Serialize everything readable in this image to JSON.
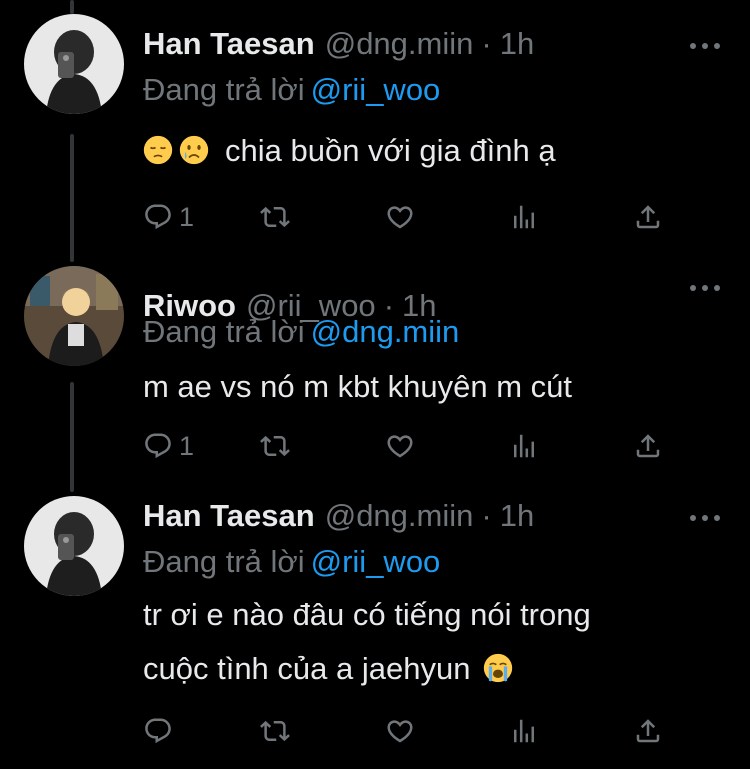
{
  "tweets": [
    {
      "name": "Han Taesan",
      "handle": "@dng.miin",
      "separator": "·",
      "time": "1h",
      "replying_prefix": "Đang trả lời",
      "replying_to": "@rii_woo",
      "text": "chia buồn với gia đình ạ",
      "leading_emojis": [
        "pensive-face",
        "crying-face"
      ],
      "reply_count": "1"
    },
    {
      "name": "Riwoo",
      "handle": "@rii_woo",
      "separator": "·",
      "time": "1h",
      "replying_prefix": "Đang trả lời",
      "replying_to": "@dng.miin",
      "text": "m ae vs nó m kbt khuyên m cút",
      "reply_count": "1"
    },
    {
      "name": "Han Taesan",
      "handle": "@dng.miin",
      "separator": "·",
      "time": "1h",
      "replying_prefix": "Đang trả lời",
      "replying_to": "@rii_woo",
      "text_line1": "tr ơi e nào đâu có tiếng nói trong",
      "text_line2": "cuộc tình của a jaehyun",
      "trailing_emoji": "loudly-crying-face",
      "reply_count": ""
    }
  ],
  "colors": {
    "background": "#000000",
    "primary_text": "#e7e9ea",
    "secondary_text": "#71767b",
    "link": "#1d9bf0"
  }
}
